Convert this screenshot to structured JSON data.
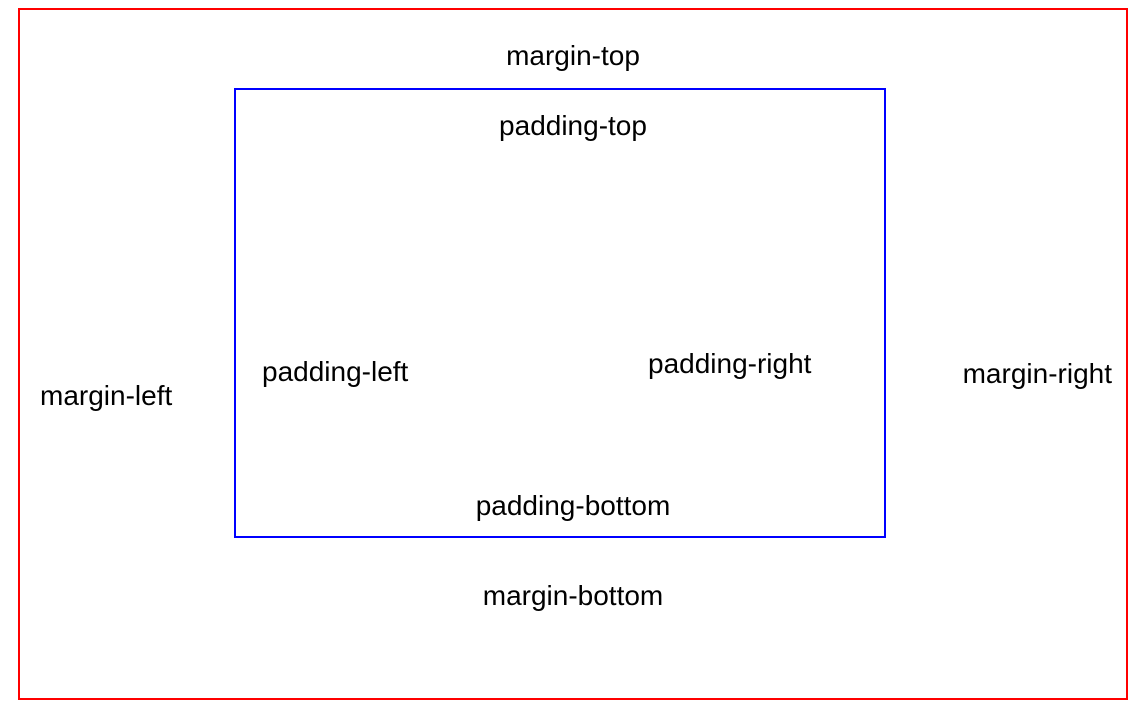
{
  "labels": {
    "margin_top": "margin-top",
    "margin_left": "margin-left",
    "margin_right": "margin-right",
    "margin_bottom": "margin-bottom",
    "padding_top": "padding-top",
    "padding_left": "padding-left",
    "padding_right": "padding-right",
    "padding_bottom": "padding-bottom"
  },
  "colors": {
    "outer_border": "#ff0000",
    "inner_border": "#0000ff"
  }
}
